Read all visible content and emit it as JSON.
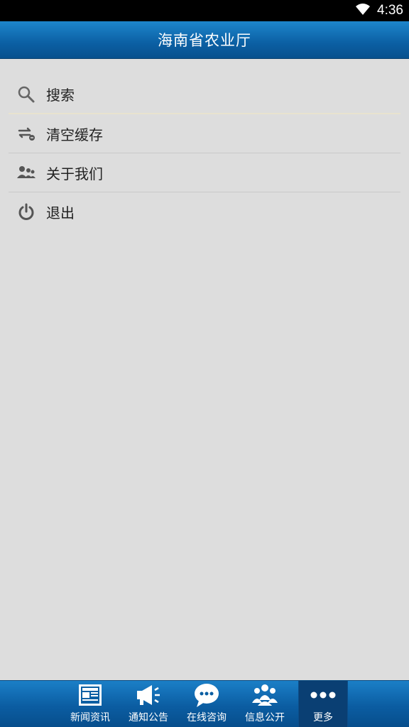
{
  "status_bar": {
    "time": "4:36"
  },
  "header": {
    "title": "海南省农业厅"
  },
  "menu": {
    "items": [
      {
        "label": "搜索",
        "icon": "search-icon"
      },
      {
        "label": "清空缓存",
        "icon": "clear-cache-icon"
      },
      {
        "label": "关于我们",
        "icon": "users-icon"
      },
      {
        "label": "退出",
        "icon": "power-icon"
      }
    ]
  },
  "bottom_nav": {
    "items": [
      {
        "label": "新闻资讯",
        "icon": "newspaper-icon"
      },
      {
        "label": "通知公告",
        "icon": "megaphone-icon"
      },
      {
        "label": "在线咨询",
        "icon": "chat-bubble-icon"
      },
      {
        "label": "信息公开",
        "icon": "group-icon"
      },
      {
        "label": "更多",
        "icon": "more-dots-icon"
      }
    ],
    "active_index": 4
  },
  "colors": {
    "header_blue": "#0b5fa3",
    "background": "#dddddd",
    "icon_gray": "#555555"
  }
}
